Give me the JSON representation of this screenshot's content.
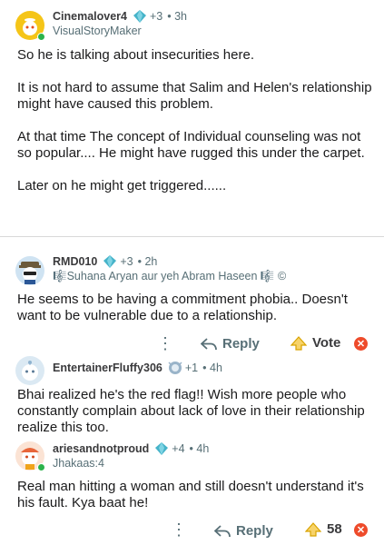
{
  "comments": [
    {
      "username": "Cinemalover4",
      "karma": "+3",
      "time": "3h",
      "flair": "VisualStoryMaker",
      "paragraphs": [
        "So he is talking about insecurities here.",
        "It is not hard to assume that Salim and Helen's relationship might have caused this problem.",
        "At that time The concept of Individual counseling was not so popular.... He might have rugged this under the carpet.",
        "Later on he might get triggered......"
      ]
    },
    {
      "username": "RMD010",
      "karma": "+3",
      "time": "2h",
      "flair": "Suhana Aryan aur yeh Abram Haseen",
      "body": "He seems to be having a commitment phobia.. Doesn't want to be vulnerable due to a relationship.",
      "actions": {
        "more": "⋮",
        "reply": "Reply",
        "vote": "Vote"
      }
    },
    {
      "username": "EntertainerFluffy306",
      "karma": "+1",
      "time": "4h",
      "body": "Bhai realized he's the red flag!! Wish more people who constantly complain about lack of love in their relationship realize this too."
    },
    {
      "username": "ariesandnotproud",
      "karma": "+4",
      "time": "4h",
      "flair": "Jhakaas:4",
      "body": "Real man hitting a woman and still doesn't understand it's his fault. Kya baat he!",
      "actions": {
        "more": "⋮",
        "reply": "Reply",
        "vote": "58"
      }
    }
  ],
  "colors": {
    "accent_teal": "#46b3c9",
    "downvote": "#ee4b2b",
    "upvote": "#f2b90c",
    "online": "#2bb34b"
  },
  "icons": {
    "karma": "gem-icon",
    "reply": "reply-arrow-icon",
    "upvote": "upvote-arrow-icon",
    "downvote": "downvote-x-icon"
  }
}
